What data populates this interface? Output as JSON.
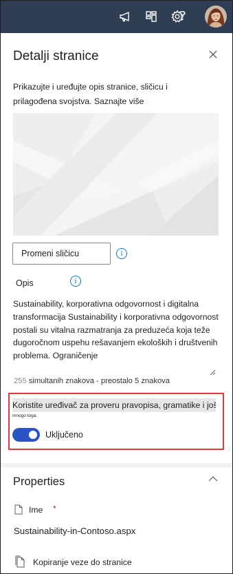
{
  "topbar": {
    "icons": [
      "megaphone-icon",
      "apps-switch-icon",
      "gear-icon",
      "help-icon"
    ],
    "help_glyph": "?",
    "background": "#2f3e52"
  },
  "panel": {
    "title": "Detalji stranice",
    "description": "Prikazujte i uređujte opis stranice, sličicu i prilagođena svojstva.",
    "learn_more": "Saznajte više",
    "change_thumbnail_label": "Promeni sličicu",
    "description_label": "Opis",
    "description_value": "Sustainability, korporativna odgovornost i digitalna transformacija Sustainability i korporativna odgovornost postali su vitalna razmatranja za preduzeća koja teže dugoročnom uspehu rešavanjem ekoloških i društvenih problema. Ograničenje",
    "char_count": "255",
    "char_count_text": "simultanih znakova - preostalo 5 znakova",
    "spellcheck_text": "Koristite uređivač za proveru pravopisa, gramatike i još",
    "spellcheck_text_small": "mnogo toga.",
    "toggle_label": "Uključeno",
    "toggle_on": true
  },
  "properties": {
    "title": "Properties",
    "name_label": "Ime",
    "required_mark": "*",
    "file_name": "Sustainability-in-Contoso.aspx",
    "copy_link_label": "Kopiranje veze do stranice"
  },
  "colors": {
    "accent": "#2b53c4",
    "highlight": "#e03c3c",
    "info": "#0078d4"
  }
}
